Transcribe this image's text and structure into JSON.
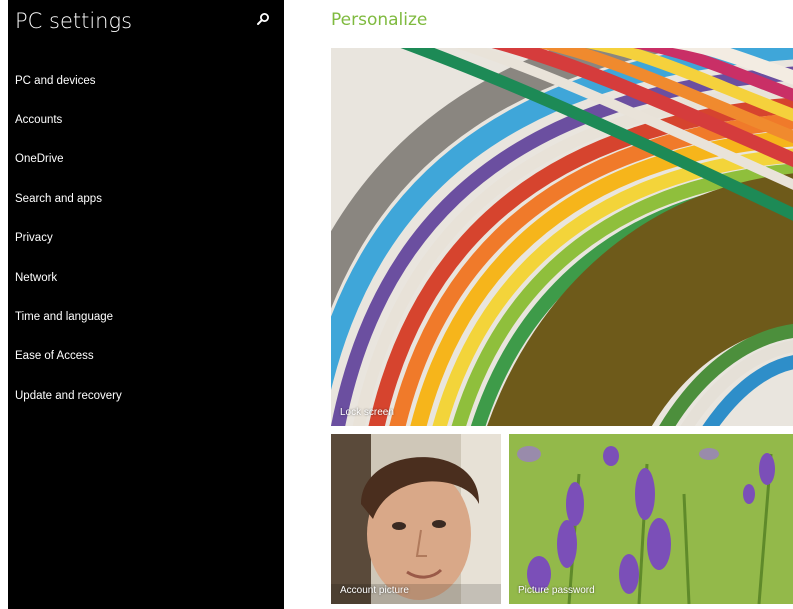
{
  "sidebar": {
    "title": "PC settings",
    "search_icon": "search-icon",
    "items": [
      {
        "label": "PC and devices"
      },
      {
        "label": "Accounts"
      },
      {
        "label": "OneDrive"
      },
      {
        "label": "Search and apps"
      },
      {
        "label": "Privacy"
      },
      {
        "label": "Network"
      },
      {
        "label": "Time and language"
      },
      {
        "label": "Ease of Access"
      },
      {
        "label": "Update and recovery"
      }
    ]
  },
  "main": {
    "title": "Personalize",
    "title_color": "#7fba3f",
    "tiles": {
      "lock_screen": {
        "label": "Lock screen"
      },
      "account_picture": {
        "label": "Account picture"
      },
      "picture_password": {
        "label": "Picture password"
      }
    }
  }
}
